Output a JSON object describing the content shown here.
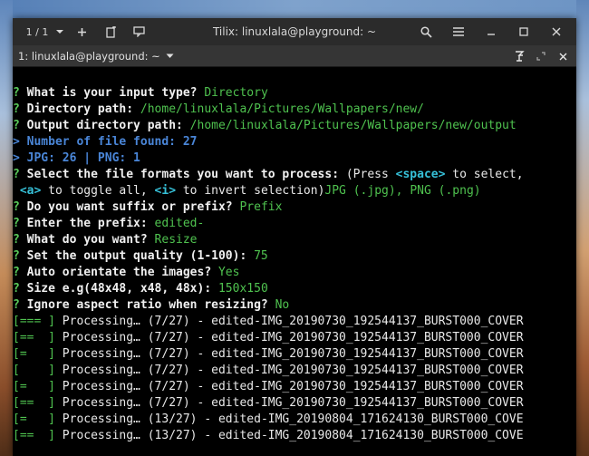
{
  "window": {
    "title": "Tilix: linuxlala@playground: ~",
    "session_counter": "1 / 1"
  },
  "tab": {
    "label": "1: linuxlala@playground: ~"
  },
  "icons": {
    "session_dropdown": "chevron-down-icon",
    "add": "plus-icon",
    "add_session": "add-session-icon",
    "sync": "sync-input-icon",
    "search": "search-icon",
    "menu": "hamburger-menu-icon",
    "minimize": "minimize-icon",
    "maximize": "maximize-icon",
    "close": "close-icon",
    "read_only": "read-only-icon",
    "tab_maximize": "maximize-terminal-icon",
    "tab_close": "close-icon"
  },
  "terminal": {
    "lines": [
      {
        "segments": [
          {
            "t": "? ",
            "c": "q"
          },
          {
            "t": "What is your input type? ",
            "c": "w"
          },
          {
            "t": "Directory",
            "c": "g"
          }
        ]
      },
      {
        "segments": [
          {
            "t": "? ",
            "c": "q"
          },
          {
            "t": "Directory path: ",
            "c": "w"
          },
          {
            "t": "/home/linuxlala/Pictures/Wallpapers/new/",
            "c": "g"
          }
        ]
      },
      {
        "segments": [
          {
            "t": "? ",
            "c": "q"
          },
          {
            "t": "Output directory path: ",
            "c": "w"
          },
          {
            "t": "/home/linuxlala/Pictures/Wallpapers/new/output",
            "c": "g"
          }
        ]
      },
      {
        "segments": [
          {
            "t": "> Number of file found: 27",
            "c": "b"
          }
        ]
      },
      {
        "segments": [
          {
            "t": "> JPG: 26 | PNG: 1",
            "c": "b"
          }
        ]
      },
      {
        "segments": [
          {
            "t": "? ",
            "c": "q"
          },
          {
            "t": "Select the file formats you want to process: ",
            "c": "w"
          },
          {
            "t": "(Press ",
            "c": "p"
          },
          {
            "t": "<space>",
            "c": "c"
          },
          {
            "t": " to select,",
            "c": "p"
          }
        ]
      },
      {
        "segments": [
          {
            "t": " ",
            "c": "p"
          },
          {
            "t": "<a>",
            "c": "c"
          },
          {
            "t": " to toggle all, ",
            "c": "p"
          },
          {
            "t": "<i>",
            "c": "c"
          },
          {
            "t": " to invert selection)",
            "c": "p"
          },
          {
            "t": "JPG (.jpg), PNG (.png)",
            "c": "g"
          }
        ]
      },
      {
        "segments": [
          {
            "t": "? ",
            "c": "q"
          },
          {
            "t": "Do you want suffix or prefix? ",
            "c": "w"
          },
          {
            "t": "Prefix",
            "c": "g"
          }
        ]
      },
      {
        "segments": [
          {
            "t": "? ",
            "c": "q"
          },
          {
            "t": "Enter the prefix: ",
            "c": "w"
          },
          {
            "t": "edited-",
            "c": "g"
          }
        ]
      },
      {
        "segments": [
          {
            "t": "? ",
            "c": "q"
          },
          {
            "t": "What do you want? ",
            "c": "w"
          },
          {
            "t": "Resize",
            "c": "g"
          }
        ]
      },
      {
        "segments": [
          {
            "t": "? ",
            "c": "q"
          },
          {
            "t": "Set the output quality (1-100): ",
            "c": "w"
          },
          {
            "t": "75",
            "c": "g"
          }
        ]
      },
      {
        "segments": [
          {
            "t": "? ",
            "c": "q"
          },
          {
            "t": "Auto orientate the images? ",
            "c": "w"
          },
          {
            "t": "Yes",
            "c": "g"
          }
        ]
      },
      {
        "segments": [
          {
            "t": "? ",
            "c": "q"
          },
          {
            "t": "Size e.g(48x48, x48, 48x): ",
            "c": "w"
          },
          {
            "t": "150x150",
            "c": "g"
          }
        ]
      },
      {
        "segments": [
          {
            "t": "? ",
            "c": "q"
          },
          {
            "t": "Ignore aspect ratio when resizing? ",
            "c": "w"
          },
          {
            "t": "No",
            "c": "g"
          }
        ]
      },
      {
        "segments": [
          {
            "t": "[=== ]",
            "c": "g"
          },
          {
            "t": " Processing… (7/27) - edited-IMG_20190730_192544137_BURST000_COVER",
            "c": "p"
          }
        ]
      },
      {
        "segments": [
          {
            "t": "[==  ]",
            "c": "g"
          },
          {
            "t": " Processing… (7/27) - edited-IMG_20190730_192544137_BURST000_COVER",
            "c": "p"
          }
        ]
      },
      {
        "segments": [
          {
            "t": "[=   ]",
            "c": "g"
          },
          {
            "t": " Processing… (7/27) - edited-IMG_20190730_192544137_BURST000_COVER",
            "c": "p"
          }
        ]
      },
      {
        "segments": [
          {
            "t": "[    ]",
            "c": "g"
          },
          {
            "t": " Processing… (7/27) - edited-IMG_20190730_192544137_BURST000_COVER",
            "c": "p"
          }
        ]
      },
      {
        "segments": [
          {
            "t": "[=   ]",
            "c": "g"
          },
          {
            "t": " Processing… (7/27) - edited-IMG_20190730_192544137_BURST000_COVER",
            "c": "p"
          }
        ]
      },
      {
        "segments": [
          {
            "t": "[==  ]",
            "c": "g"
          },
          {
            "t": " Processing… (7/27) - edited-IMG_20190730_192544137_BURST000_COVER",
            "c": "p"
          }
        ]
      },
      {
        "segments": [
          {
            "t": "[=   ]",
            "c": "g"
          },
          {
            "t": " Processing… (13/27) - edited-IMG_20190804_171624130_BURST000_COVE",
            "c": "p"
          }
        ]
      },
      {
        "segments": [
          {
            "t": "[==  ]",
            "c": "g"
          },
          {
            "t": " Processing… (13/27) - edited-IMG_20190804_171624130_BURST000_COVE",
            "c": "p"
          }
        ]
      }
    ]
  },
  "colors": {
    "prompt_green": "#5bcc5b",
    "answer_green": "#4fc24f",
    "info_blue": "#4a86d8",
    "key_cyan": "#36c0d8",
    "titlebar": "#2b2b2b",
    "tabbar": "#353535"
  }
}
